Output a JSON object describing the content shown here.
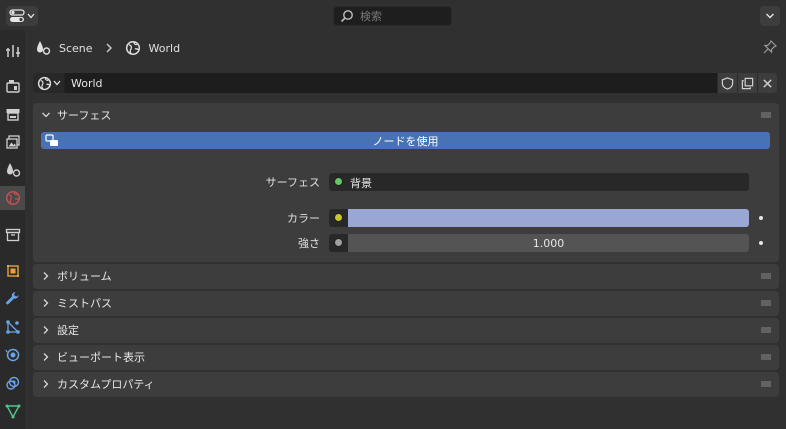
{
  "header": {
    "search_placeholder": "検索"
  },
  "breadcrumb": {
    "scene_label": "Scene",
    "world_label": "World"
  },
  "world_selector": {
    "name": "World"
  },
  "surface_panel": {
    "title": "サーフェス",
    "use_nodes_label": "ノードを使用",
    "surface_label": "サーフェス",
    "surface_value": "背景",
    "color_label": "カラー",
    "color_value": "#9aa6d3",
    "strength_label": "強さ",
    "strength_value": "1.000"
  },
  "collapsed_panels": [
    {
      "title": "ボリューム"
    },
    {
      "title": "ミストパス"
    },
    {
      "title": "設定"
    },
    {
      "title": "ビューポート表示"
    },
    {
      "title": "カスタムプロパティ"
    }
  ],
  "colors": {
    "accent": "#4772b3",
    "socket_green": "#63c763",
    "socket_yellow": "#c7c729",
    "socket_gray": "#a1a1a1",
    "world_tab": "#c04f53"
  },
  "tabs": [
    {
      "icon": "tool-icon"
    },
    {
      "icon": "render-icon"
    },
    {
      "icon": "output-icon"
    },
    {
      "icon": "view-layer-icon"
    },
    {
      "icon": "scene-icon"
    },
    {
      "icon": "world-icon"
    },
    {
      "icon": "collection-icon"
    },
    {
      "icon": "object-icon"
    },
    {
      "icon": "modifier-icon"
    },
    {
      "icon": "particles-icon"
    },
    {
      "icon": "physics-icon"
    },
    {
      "icon": "constraints-icon"
    },
    {
      "icon": "data-icon"
    }
  ]
}
